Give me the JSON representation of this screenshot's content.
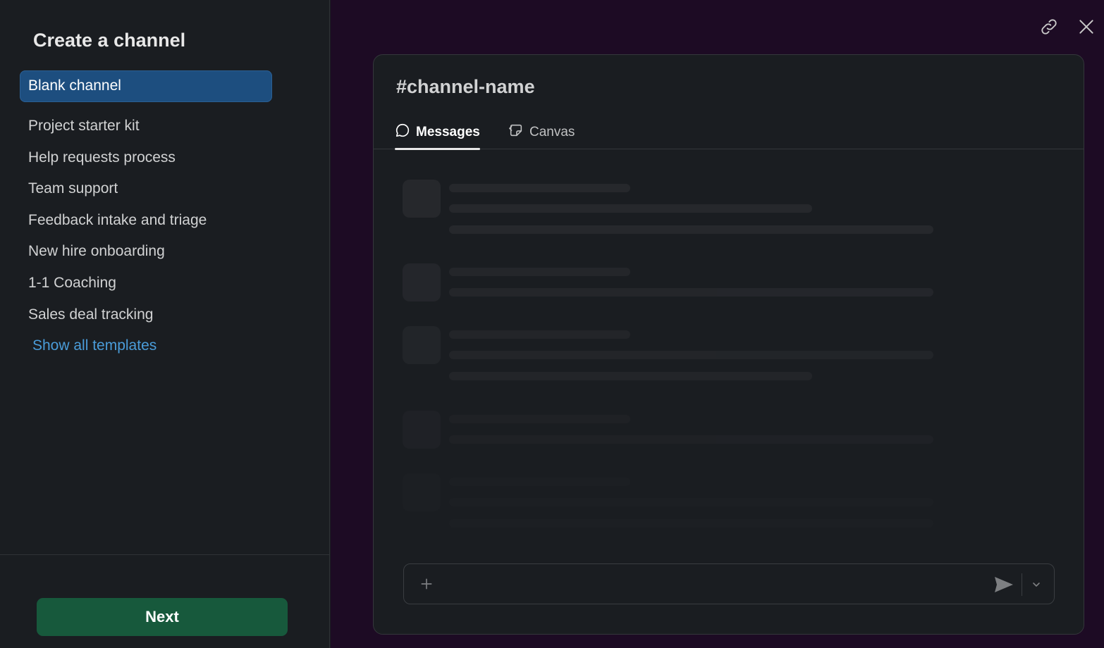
{
  "sidebar": {
    "title": "Create a channel",
    "templates": [
      {
        "label": "Blank channel",
        "active": true
      },
      {
        "label": "Project starter kit"
      },
      {
        "label": "Help requests process"
      },
      {
        "label": "Team support"
      },
      {
        "label": "Feedback intake and triage"
      },
      {
        "label": "New hire onboarding"
      },
      {
        "label": "1-1 Coaching"
      },
      {
        "label": "Sales deal tracking"
      }
    ],
    "show_all_label": "Show all templates",
    "next_label": "Next"
  },
  "header_icons": [
    "link-icon",
    "close-icon"
  ],
  "preview": {
    "hash": "#",
    "channel_name": "channel-name",
    "tabs": [
      {
        "label": "Messages",
        "icon": "message-bubble-icon",
        "active": true
      },
      {
        "label": "Canvas",
        "icon": "canvas-icon"
      }
    ],
    "composer_icons": [
      "plus-icon",
      "send-icon",
      "chevron-down-icon"
    ]
  },
  "colors": {
    "active_template_bg": "#1d4e7f",
    "link_color": "#4a9cd9",
    "next_button_bg": "#17593c",
    "backdrop": "#1d0b24"
  }
}
